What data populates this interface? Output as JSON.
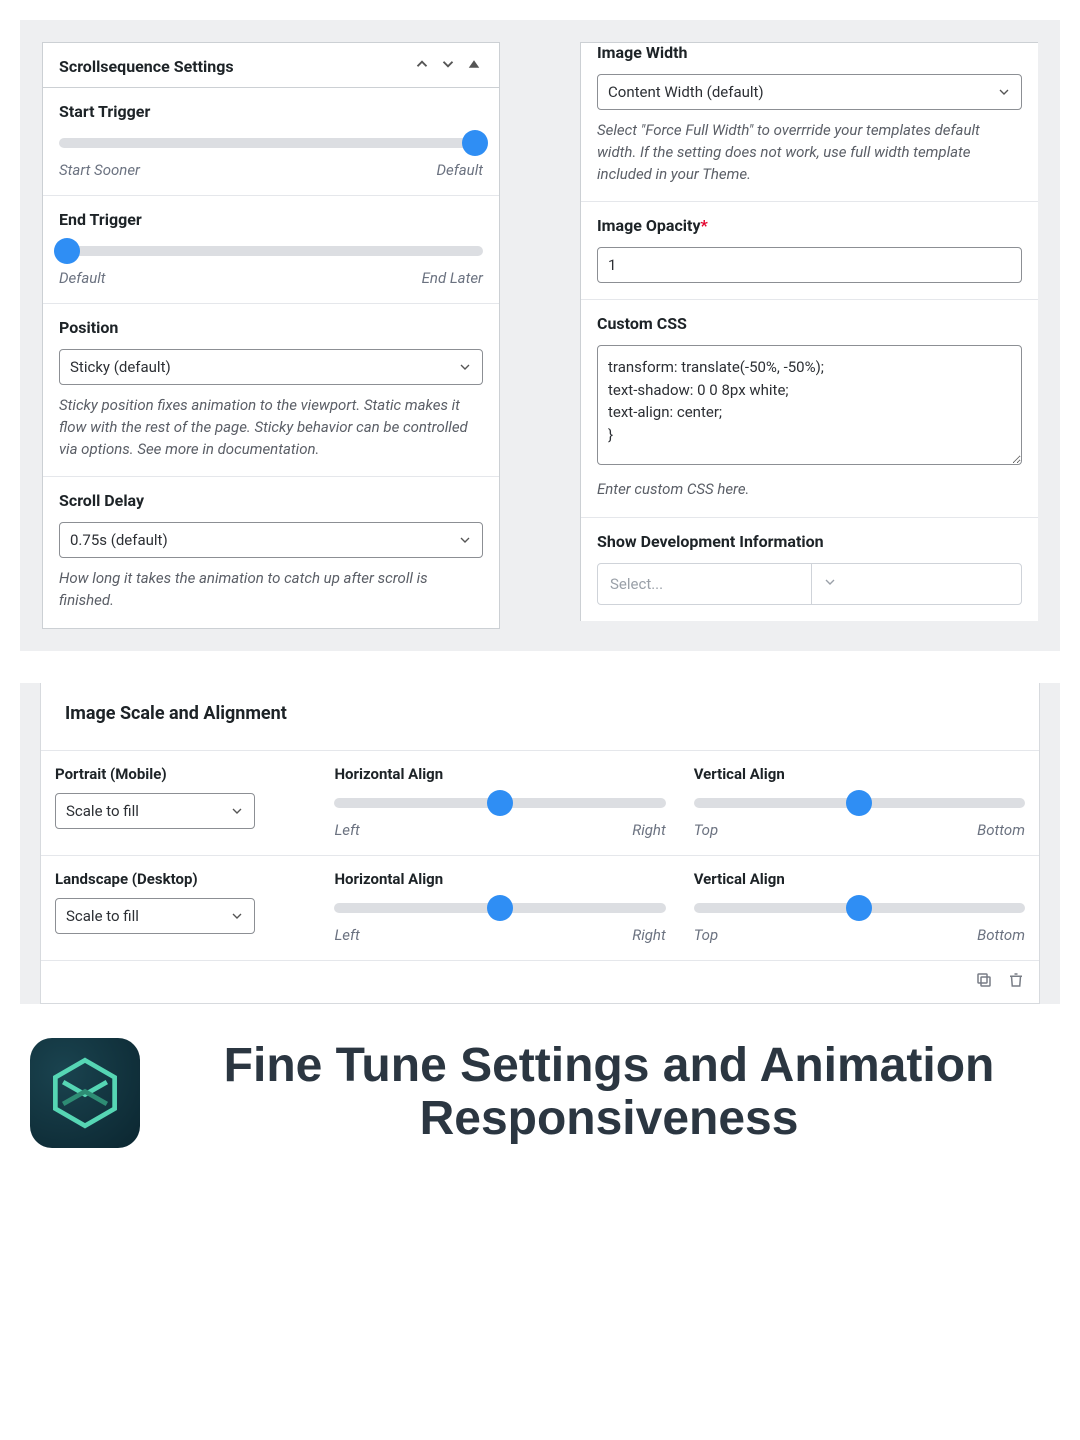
{
  "panel": {
    "title": "Scrollsequence Settings",
    "start_trigger": {
      "title": "Start Trigger",
      "left": "Start Sooner",
      "right": "Default",
      "pos": 100
    },
    "end_trigger": {
      "title": "End Trigger",
      "left": "Default",
      "right": "End Later",
      "pos": 0
    },
    "position": {
      "title": "Position",
      "value": "Sticky (default)",
      "help": "Sticky position fixes animation to the viewport. Static makes it flow with the rest of the page. Sticky behavior can be controlled via options. See more in documentation."
    },
    "scroll_delay": {
      "title": "Scroll Delay",
      "value": "0.75s (default)",
      "help": "How long it takes the animation to catch up after scroll is finished."
    }
  },
  "right": {
    "image_width": {
      "title": "Image Width",
      "value": "Content Width (default)",
      "help": "Select \"Force Full Width\" to overrride your templates default width. If the setting does not work, use full width template included in your Theme."
    },
    "opacity": {
      "title": "Image Opacity",
      "value": "1"
    },
    "custom_css": {
      "title": "Custom CSS",
      "value": "transform: translate(-50%, -50%);\ntext-shadow: 0 0 8px white;\ntext-align: center;\n}",
      "help": "Enter custom CSS here."
    },
    "dev": {
      "title": "Show Development Information",
      "placeholder": "Select..."
    }
  },
  "align": {
    "title": "Image Scale and Alignment",
    "portrait": {
      "label": "Portrait (Mobile)",
      "value": "Scale to fill"
    },
    "landscape": {
      "label": "Landscape (Desktop)",
      "value": "Scale to fill"
    },
    "h": {
      "label": "Horizontal Align",
      "left": "Left",
      "right": "Right",
      "pos": 50
    },
    "v": {
      "label": "Vertical Align",
      "left": "Top",
      "right": "Bottom",
      "pos": 50
    }
  },
  "hero": {
    "title": "Fine Tune Settings and Animation Responsiveness"
  }
}
